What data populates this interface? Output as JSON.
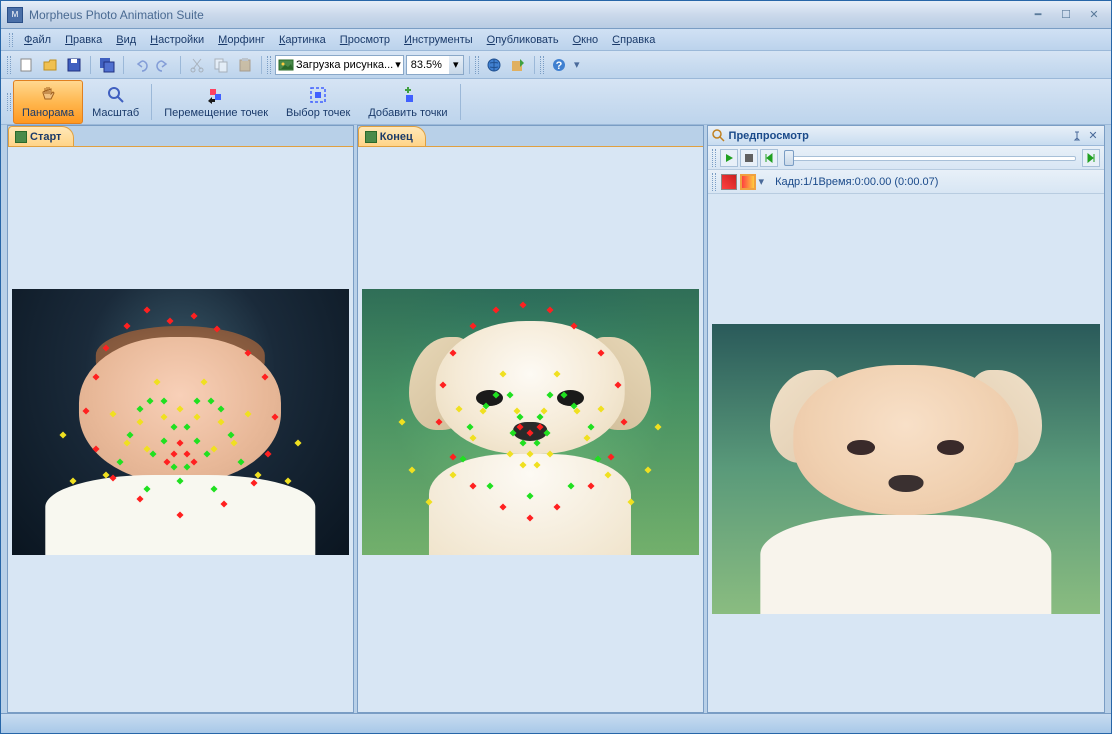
{
  "app": {
    "title": "Morpheus Photo Animation Suite"
  },
  "menu": {
    "file": "Файл",
    "edit": "Правка",
    "view": "Вид",
    "settings": "Настройки",
    "morphing": "Морфинг",
    "picture": "Картинка",
    "preview": "Просмотр",
    "tools": "Инструменты",
    "publish": "Опубликовать",
    "window": "Окно",
    "help": "Справка"
  },
  "toolbar1": {
    "load_picture": "Загрузка рисунка...",
    "zoom_value": "83.5%"
  },
  "toolbar2": {
    "panorama": "Панорама",
    "scale": "Масштаб",
    "move_points": "Перемещение точек",
    "select_points": "Выбор точек",
    "add_points": "Добавить точки"
  },
  "panels": {
    "start_tab": "Старт",
    "end_tab": "Конец",
    "preview_title": "Предпросмотр",
    "preview_info": "Кадр:1/1Время:0:00.00 (0:00.07)"
  },
  "dots_start": [
    [
      47,
      12,
      "r"
    ],
    [
      40,
      8,
      "r"
    ],
    [
      54,
      10,
      "r"
    ],
    [
      34,
      14,
      "r"
    ],
    [
      61,
      15,
      "r"
    ],
    [
      28,
      22,
      "r"
    ],
    [
      70,
      24,
      "r"
    ],
    [
      25,
      33,
      "r"
    ],
    [
      75,
      33,
      "r"
    ],
    [
      22,
      46,
      "r"
    ],
    [
      78,
      48,
      "r"
    ],
    [
      25,
      60,
      "r"
    ],
    [
      76,
      62,
      "r"
    ],
    [
      30,
      71,
      "r"
    ],
    [
      72,
      73,
      "r"
    ],
    [
      38,
      79,
      "r"
    ],
    [
      63,
      81,
      "r"
    ],
    [
      50,
      85,
      "r"
    ],
    [
      41,
      42,
      "g"
    ],
    [
      45,
      42,
      "g"
    ],
    [
      55,
      42,
      "g"
    ],
    [
      59,
      42,
      "g"
    ],
    [
      38,
      45,
      "g"
    ],
    [
      62,
      45,
      "g"
    ],
    [
      48,
      52,
      "g"
    ],
    [
      52,
      52,
      "g"
    ],
    [
      45,
      57,
      "g"
    ],
    [
      55,
      57,
      "g"
    ],
    [
      42,
      62,
      "g"
    ],
    [
      58,
      62,
      "g"
    ],
    [
      48,
      67,
      "g"
    ],
    [
      52,
      67,
      "g"
    ],
    [
      50,
      72,
      "g"
    ],
    [
      35,
      55,
      "g"
    ],
    [
      65,
      55,
      "g"
    ],
    [
      32,
      65,
      "g"
    ],
    [
      68,
      65,
      "g"
    ],
    [
      40,
      75,
      "g"
    ],
    [
      60,
      75,
      "g"
    ],
    [
      43,
      35,
      "y"
    ],
    [
      57,
      35,
      "y"
    ],
    [
      38,
      50,
      "y"
    ],
    [
      62,
      50,
      "y"
    ],
    [
      34,
      58,
      "y"
    ],
    [
      66,
      58,
      "y"
    ],
    [
      30,
      47,
      "y"
    ],
    [
      70,
      47,
      "y"
    ],
    [
      28,
      70,
      "y"
    ],
    [
      73,
      70,
      "y"
    ],
    [
      45,
      48,
      "y"
    ],
    [
      55,
      48,
      "y"
    ],
    [
      50,
      45,
      "y"
    ],
    [
      40,
      60,
      "y"
    ],
    [
      60,
      60,
      "y"
    ],
    [
      48,
      62,
      "r"
    ],
    [
      52,
      62,
      "r"
    ],
    [
      50,
      58,
      "r"
    ],
    [
      46,
      65,
      "r"
    ],
    [
      54,
      65,
      "r"
    ],
    [
      15,
      55,
      "y"
    ],
    [
      85,
      58,
      "y"
    ],
    [
      18,
      72,
      "y"
    ],
    [
      82,
      72,
      "y"
    ]
  ],
  "dots_end": [
    [
      48,
      6,
      "r"
    ],
    [
      40,
      8,
      "r"
    ],
    [
      56,
      8,
      "r"
    ],
    [
      33,
      14,
      "r"
    ],
    [
      63,
      14,
      "r"
    ],
    [
      27,
      24,
      "r"
    ],
    [
      71,
      24,
      "r"
    ],
    [
      24,
      36,
      "r"
    ],
    [
      76,
      36,
      "r"
    ],
    [
      23,
      50,
      "r"
    ],
    [
      78,
      50,
      "r"
    ],
    [
      27,
      63,
      "r"
    ],
    [
      74,
      63,
      "r"
    ],
    [
      33,
      74,
      "r"
    ],
    [
      68,
      74,
      "r"
    ],
    [
      42,
      82,
      "r"
    ],
    [
      58,
      82,
      "r"
    ],
    [
      50,
      86,
      "r"
    ],
    [
      40,
      40,
      "g"
    ],
    [
      44,
      40,
      "g"
    ],
    [
      56,
      40,
      "g"
    ],
    [
      60,
      40,
      "g"
    ],
    [
      37,
      44,
      "g"
    ],
    [
      63,
      44,
      "g"
    ],
    [
      47,
      48,
      "g"
    ],
    [
      53,
      48,
      "g"
    ],
    [
      45,
      54,
      "g"
    ],
    [
      55,
      54,
      "g"
    ],
    [
      48,
      58,
      "g"
    ],
    [
      52,
      58,
      "g"
    ],
    [
      50,
      54,
      "r"
    ],
    [
      47,
      52,
      "r"
    ],
    [
      53,
      52,
      "r"
    ],
    [
      32,
      52,
      "g"
    ],
    [
      68,
      52,
      "g"
    ],
    [
      30,
      64,
      "g"
    ],
    [
      70,
      64,
      "g"
    ],
    [
      38,
      74,
      "g"
    ],
    [
      62,
      74,
      "g"
    ],
    [
      50,
      78,
      "g"
    ],
    [
      42,
      32,
      "y"
    ],
    [
      58,
      32,
      "y"
    ],
    [
      36,
      46,
      "y"
    ],
    [
      64,
      46,
      "y"
    ],
    [
      33,
      56,
      "y"
    ],
    [
      67,
      56,
      "y"
    ],
    [
      29,
      45,
      "y"
    ],
    [
      71,
      45,
      "y"
    ],
    [
      27,
      70,
      "y"
    ],
    [
      73,
      70,
      "y"
    ],
    [
      46,
      46,
      "y"
    ],
    [
      54,
      46,
      "y"
    ],
    [
      50,
      62,
      "y"
    ],
    [
      44,
      62,
      "y"
    ],
    [
      56,
      62,
      "y"
    ],
    [
      12,
      50,
      "y"
    ],
    [
      88,
      52,
      "y"
    ],
    [
      15,
      68,
      "y"
    ],
    [
      85,
      68,
      "y"
    ],
    [
      20,
      80,
      "y"
    ],
    [
      80,
      80,
      "y"
    ],
    [
      48,
      66,
      "y"
    ],
    [
      52,
      66,
      "y"
    ]
  ]
}
